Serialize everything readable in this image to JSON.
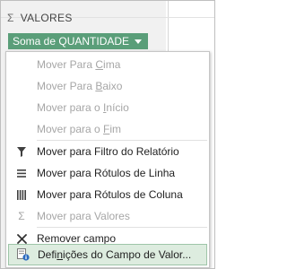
{
  "pane": {
    "section_icon": "sigma-icon",
    "section_title": "VALORES",
    "field_chip_label": "Soma de QUANTIDADE",
    "field_chip_color": "#5a9e79"
  },
  "menu": {
    "items": [
      {
        "pre": "Mover Para ",
        "key": "C",
        "post": "ima",
        "enabled": false,
        "icon": null
      },
      {
        "pre": "Mover Para ",
        "key": "B",
        "post": "aixo",
        "enabled": false,
        "icon": null
      },
      {
        "pre": "Mover para o ",
        "key": "I",
        "post": "nício",
        "enabled": false,
        "icon": null
      },
      {
        "pre": "Mover para o ",
        "key": "F",
        "post": "im",
        "enabled": false,
        "icon": null
      },
      {
        "pre": "Mover para Filtro do Relatório",
        "key": "",
        "post": "",
        "enabled": true,
        "icon": "filter-icon"
      },
      {
        "pre": "Mover para Rótulos de Linha",
        "key": "",
        "post": "",
        "enabled": true,
        "icon": "rows-icon"
      },
      {
        "pre": "Mover para Rótulos de Coluna",
        "key": "",
        "post": "",
        "enabled": true,
        "icon": "columns-icon"
      },
      {
        "pre": "Mover para Valores",
        "key": "",
        "post": "",
        "enabled": false,
        "icon": "sigma-icon"
      },
      {
        "pre": "Remover campo",
        "key": "",
        "post": "",
        "enabled": true,
        "icon": "close-icon"
      },
      {
        "pre": "Defi",
        "key": "n",
        "post": "ições do Campo de Valor...",
        "enabled": true,
        "icon": "field-settings-icon",
        "selected": true
      }
    ]
  },
  "colors": {
    "selected_bg": "#ddecdf",
    "selected_border": "#9ec5a8",
    "disabled_text": "#a6a6a6"
  }
}
